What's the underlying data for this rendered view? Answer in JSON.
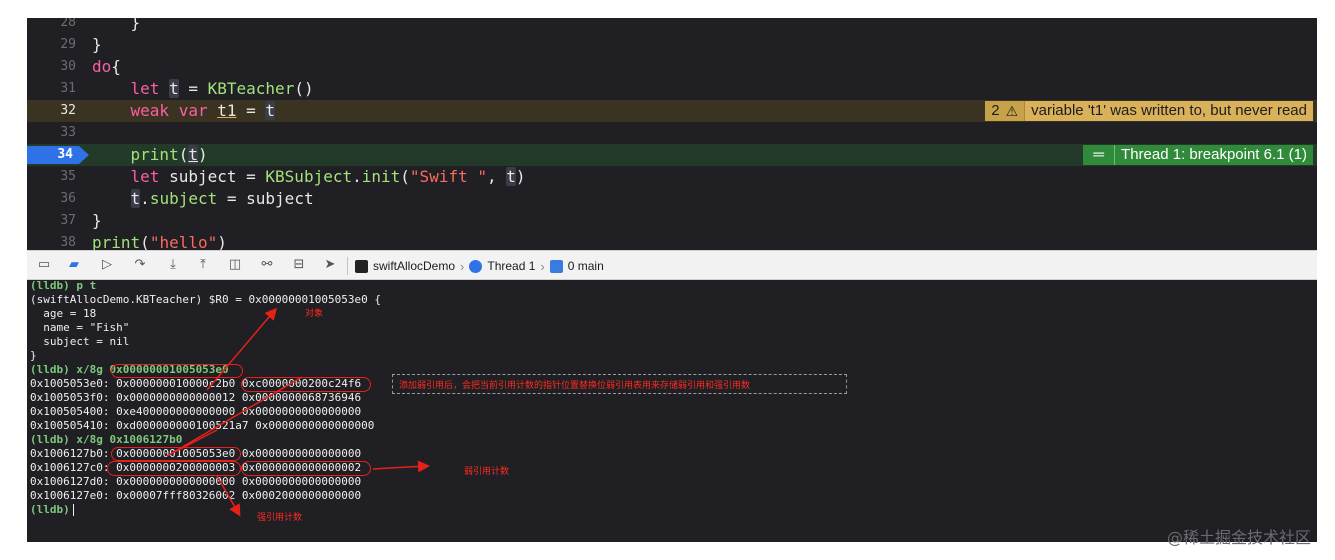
{
  "editor": {
    "lines": [
      {
        "num": "28",
        "text": "    }"
      },
      {
        "num": "29",
        "text": "}"
      },
      {
        "num": "30",
        "text": "do{"
      },
      {
        "num": "31",
        "text": "    let t = KBTeacher()"
      },
      {
        "num": "32",
        "text": "    weak var t1 = t"
      },
      {
        "num": "33",
        "text": ""
      },
      {
        "num": "34",
        "text": "    print(t)"
      },
      {
        "num": "35",
        "text": "    let subject = KBSubject.init(\"Swift \", t)"
      },
      {
        "num": "36",
        "text": "    t.subject = subject"
      },
      {
        "num": "37",
        "text": "}"
      },
      {
        "num": "38",
        "text": "print(\"hello\")"
      }
    ],
    "warning": {
      "count": "2",
      "icon": "warning-triangle-icon",
      "message": "variable 't1' was written to, but never read"
    },
    "breakpoint": {
      "message": "Thread 1: breakpoint 6.1 (1)"
    }
  },
  "debug_bar": {
    "breadcrumbs": [
      {
        "label": "swiftAllocDemo",
        "icon": "terminal-app-icon"
      },
      {
        "label": "Thread 1",
        "icon": "thread-icon"
      },
      {
        "label": "0 main",
        "icon": "frame-person-icon"
      }
    ]
  },
  "console": {
    "lines": [
      "(lldb) p t",
      "(swiftAllocDemo.KBTeacher) $R0 = 0x00000001005053e0 {",
      "  age = 18",
      "  name = \"Fish\"",
      "  subject = nil",
      "}",
      "(lldb) x/8g 0x00000001005053e0",
      "0x1005053e0: 0x000000010000c2b0 0xc0000000200c24f6",
      "0x1005053f0: 0x0000000000000012 0x0000000068736946",
      "0x100505400: 0xe400000000000000 0x0000000000000000",
      "0x100505410: 0xd000000000100521a7 0x0000000000000000",
      "(lldb) x/8g 0x1006127b0",
      "0x1006127b0: 0x00000001005053e0 0x0000000000000000",
      "0x1006127c0: 0x0000000200000003 0x0000000000000002",
      "0x1006127d0: 0x0000000000000000 0x0000000000000000",
      "0x1006127e0: 0x00007fff80326002 0x0002000000000000",
      "(lldb)"
    ]
  },
  "annotations": {
    "object": "对象",
    "weak_ref_note": "添加弱引用后，会把当前引用计数的指针位置替换位弱引用表用来存储弱引用和强引用数",
    "weak_count": "弱引用计数",
    "strong_count": "强引用计数"
  },
  "watermark": "@稀土掘金技术社区",
  "colors": {
    "keyword": "#fc5fa3",
    "type": "#a3e27a",
    "string": "#fc6a5d",
    "warning": "#d9b15a",
    "breakpoint": "#2f8a3a",
    "annotation": "#ff2a1f"
  }
}
